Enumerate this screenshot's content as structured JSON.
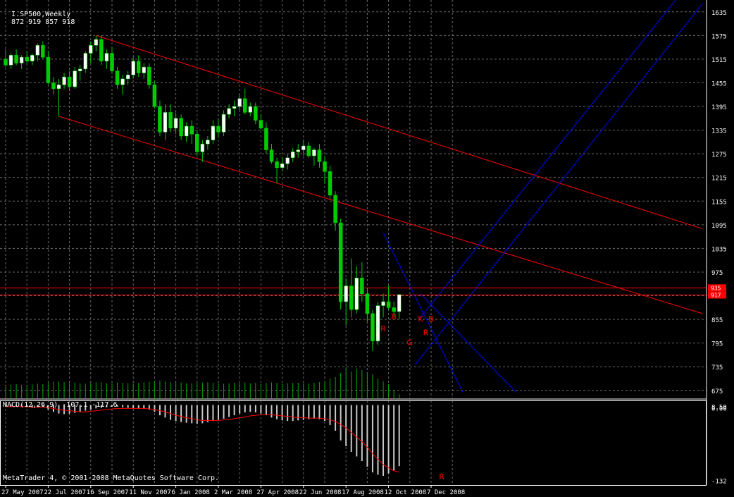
{
  "header": {
    "symbol": "I.SP500,Weekly",
    "ohlc": "872 919 857 918"
  },
  "macd_label": "MACD(12,26,9) -107.1 -117.6",
  "footer_label": "MetaTrader 4, © 2001-2008 MetaQuotes Software Corp.",
  "colors": {
    "background": "#000000",
    "grid": "#6a6a6a",
    "bull_body": "#ffffff",
    "bear_body": "#00cc00",
    "wick": "#00cc00",
    "volume": "#00aa00",
    "channel": "#ff0000",
    "pitchfork": "#0000ff",
    "price_line": "#ff0000",
    "macd_hist": "#c8c8c8",
    "signal": "#ff0000",
    "axis_text": "#ffffff",
    "marker": "#ff0000"
  },
  "chart_data": {
    "type": "candlestick",
    "price_axis": {
      "ylim": [
        655,
        1665
      ],
      "ticks": [
        1635,
        1575,
        1515,
        1455,
        1395,
        1335,
        1275,
        1215,
        1155,
        1095,
        1035,
        975,
        915,
        855,
        795,
        735,
        675
      ]
    },
    "price_marks": [
      {
        "value": 935,
        "label": "935"
      },
      {
        "value": 917,
        "label": "917"
      }
    ],
    "macd_axis": {
      "ylim": [
        -140,
        8
      ],
      "ticks": [
        {
          "value": 0,
          "label": "8.50"
        },
        {
          "value": 0,
          "label": "0.00"
        },
        {
          "value": -132,
          "label": "-132"
        }
      ]
    },
    "time_axis": {
      "labels": [
        {
          "bar": 0,
          "label": "27 May 2007"
        },
        {
          "bar": 8,
          "label": "22 Jul 2007"
        },
        {
          "bar": 16,
          "label": "16 Sep 2007"
        },
        {
          "bar": 24,
          "label": "11 Nov 2007"
        },
        {
          "bar": 32,
          "label": "6 Jan 2008"
        },
        {
          "bar": 40,
          "label": "2 Mar 2008"
        },
        {
          "bar": 48,
          "label": "27 Apr 2008"
        },
        {
          "bar": 56,
          "label": "22 Jun 2008"
        },
        {
          "bar": 64,
          "label": "17 Aug 2008"
        },
        {
          "bar": 72,
          "label": "12 Oct 2008"
        },
        {
          "bar": 80,
          "label": "7 Dec 2008"
        }
      ]
    },
    "candles": [
      [
        1515,
        1540,
        1495,
        1500
      ],
      [
        1500,
        1530,
        1490,
        1525
      ],
      [
        1525,
        1540,
        1500,
        1505
      ],
      [
        1505,
        1525,
        1490,
        1520
      ],
      [
        1520,
        1535,
        1505,
        1510
      ],
      [
        1510,
        1530,
        1500,
        1525
      ],
      [
        1525,
        1555,
        1510,
        1550
      ],
      [
        1550,
        1560,
        1515,
        1520
      ],
      [
        1520,
        1535,
        1450,
        1455
      ],
      [
        1455,
        1470,
        1425,
        1440
      ],
      [
        1440,
        1465,
        1370,
        1450
      ],
      [
        1450,
        1480,
        1440,
        1470
      ],
      [
        1470,
        1485,
        1435,
        1445
      ],
      [
        1445,
        1495,
        1440,
        1485
      ],
      [
        1485,
        1500,
        1460,
        1490
      ],
      [
        1490,
        1535,
        1480,
        1530
      ],
      [
        1530,
        1560,
        1505,
        1550
      ],
      [
        1550,
        1575,
        1535,
        1565
      ],
      [
        1565,
        1575,
        1500,
        1510
      ],
      [
        1510,
        1540,
        1490,
        1530
      ],
      [
        1530,
        1545,
        1480,
        1485
      ],
      [
        1485,
        1495,
        1440,
        1450
      ],
      [
        1450,
        1475,
        1425,
        1465
      ],
      [
        1465,
        1485,
        1450,
        1475
      ],
      [
        1475,
        1520,
        1465,
        1510
      ],
      [
        1510,
        1525,
        1470,
        1480
      ],
      [
        1480,
        1505,
        1465,
        1495
      ],
      [
        1495,
        1505,
        1440,
        1450
      ],
      [
        1450,
        1460,
        1390,
        1395
      ],
      [
        1395,
        1410,
        1320,
        1330
      ],
      [
        1330,
        1400,
        1310,
        1380
      ],
      [
        1380,
        1400,
        1330,
        1340
      ],
      [
        1340,
        1380,
        1325,
        1365
      ],
      [
        1365,
        1375,
        1310,
        1320
      ],
      [
        1320,
        1355,
        1305,
        1345
      ],
      [
        1345,
        1360,
        1300,
        1325
      ],
      [
        1325,
        1335,
        1270,
        1280
      ],
      [
        1280,
        1310,
        1255,
        1300
      ],
      [
        1300,
        1320,
        1285,
        1310
      ],
      [
        1310,
        1360,
        1300,
        1345
      ],
      [
        1345,
        1365,
        1315,
        1330
      ],
      [
        1330,
        1385,
        1320,
        1375
      ],
      [
        1375,
        1400,
        1365,
        1390
      ],
      [
        1390,
        1410,
        1370,
        1395
      ],
      [
        1395,
        1425,
        1385,
        1415
      ],
      [
        1415,
        1440,
        1375,
        1380
      ],
      [
        1380,
        1405,
        1370,
        1395
      ],
      [
        1395,
        1405,
        1350,
        1360
      ],
      [
        1360,
        1375,
        1335,
        1340
      ],
      [
        1340,
        1355,
        1275,
        1285
      ],
      [
        1285,
        1300,
        1250,
        1255
      ],
      [
        1255,
        1265,
        1200,
        1240
      ],
      [
        1240,
        1265,
        1230,
        1250
      ],
      [
        1250,
        1275,
        1235,
        1265
      ],
      [
        1265,
        1290,
        1255,
        1280
      ],
      [
        1280,
        1300,
        1265,
        1285
      ],
      [
        1285,
        1310,
        1270,
        1295
      ],
      [
        1295,
        1305,
        1265,
        1270
      ],
      [
        1270,
        1290,
        1245,
        1285
      ],
      [
        1285,
        1300,
        1240,
        1255
      ],
      [
        1255,
        1270,
        1200,
        1230
      ],
      [
        1230,
        1245,
        1160,
        1170
      ],
      [
        1170,
        1180,
        1080,
        1100
      ],
      [
        1100,
        1110,
        880,
        900
      ],
      [
        900,
        960,
        840,
        940
      ],
      [
        940,
        1010,
        860,
        880
      ],
      [
        880,
        990,
        870,
        960
      ],
      [
        960,
        1000,
        900,
        920
      ],
      [
        920,
        935,
        850,
        870
      ],
      [
        870,
        880,
        775,
        800
      ],
      [
        800,
        900,
        790,
        890
      ],
      [
        890,
        920,
        860,
        900
      ],
      [
        900,
        940,
        880,
        885
      ],
      [
        885,
        900,
        860,
        875
      ],
      [
        875,
        919,
        857,
        918
      ]
    ],
    "volume": [
      45,
      48,
      50,
      47,
      46,
      49,
      52,
      50,
      55,
      58,
      60,
      57,
      54,
      56,
      53,
      52,
      55,
      57,
      56,
      54,
      53,
      56,
      55,
      54,
      53,
      55,
      56,
      58,
      60,
      62,
      59,
      57,
      55,
      56,
      54,
      53,
      55,
      56,
      57,
      55,
      54,
      52,
      53,
      55,
      54,
      56,
      53,
      55,
      52,
      54,
      56,
      55,
      53,
      54,
      55,
      56,
      54,
      53,
      55,
      57,
      62,
      70,
      75,
      90,
      110,
      95,
      105,
      100,
      90,
      85,
      70,
      60,
      50,
      30,
      15
    ],
    "macd": [
      -3,
      -2,
      -2,
      -3,
      -4,
      -5,
      -4,
      -3,
      -8,
      -12,
      -15,
      -16,
      -15,
      -14,
      -12,
      -10,
      -8,
      -6,
      -5,
      -4,
      -3,
      -3,
      -4,
      -5,
      -6,
      -7,
      -7,
      -8,
      -12,
      -18,
      -22,
      -26,
      -28,
      -30,
      -31,
      -32,
      -33,
      -32,
      -30,
      -28,
      -26,
      -24,
      -21,
      -18,
      -15,
      -13,
      -12,
      -13,
      -15,
      -18,
      -22,
      -25,
      -27,
      -28,
      -28,
      -27,
      -26,
      -25,
      -24,
      -25,
      -28,
      -35,
      -45,
      -62,
      -72,
      -82,
      -90,
      -98,
      -108,
      -118,
      -122,
      -124,
      -120,
      -115,
      -107
    ],
    "signal": [
      -3,
      -3,
      -3,
      -3,
      -3,
      -4,
      -4,
      -4,
      -5,
      -6,
      -8,
      -9,
      -10,
      -11,
      -12,
      -12,
      -11,
      -10,
      -9,
      -8,
      -7,
      -6,
      -6,
      -6,
      -6,
      -6,
      -6,
      -7,
      -8,
      -10,
      -12,
      -15,
      -18,
      -20,
      -22,
      -24,
      -26,
      -27,
      -27,
      -27,
      -27,
      -26,
      -25,
      -24,
      -22,
      -21,
      -19,
      -18,
      -17,
      -17,
      -17,
      -18,
      -19,
      -20,
      -21,
      -22,
      -22,
      -23,
      -23,
      -23,
      -24,
      -26,
      -29,
      -34,
      -40,
      -48,
      -56,
      -64,
      -74,
      -85,
      -95,
      -104,
      -110,
      -115,
      -117.6
    ],
    "trend_lines": {
      "channel": [
        {
          "from": [
            17,
            1575
          ],
          "to": [
            131,
            1085
          ]
        },
        {
          "from": [
            10,
            1370
          ],
          "to": [
            131,
            870
          ]
        }
      ],
      "pitchfork_lines": [
        {
          "from": [
            71,
            1075
          ],
          "to": [
            86,
            670
          ]
        },
        {
          "from": [
            78,
            920
          ],
          "to": [
            96,
            670
          ]
        },
        {
          "from": [
            78,
            860
          ],
          "to": [
            126,
            1665
          ]
        },
        {
          "from": [
            77,
            740
          ],
          "to": [
            131,
            1655
          ]
        }
      ]
    },
    "markers": [
      {
        "bar": 71,
        "price": 825,
        "label": "R"
      },
      {
        "bar": 73,
        "price": 855,
        "label": "B"
      },
      {
        "bar": 76,
        "price": 790,
        "label": "G"
      },
      {
        "bar": 78,
        "price": 850,
        "label": "K"
      },
      {
        "bar": 79,
        "price": 815,
        "label": "R"
      },
      {
        "bar": 80,
        "price": 850,
        "label": "B"
      }
    ],
    "macd_marker": {
      "bar": 82,
      "value": -125,
      "label": "R"
    }
  }
}
